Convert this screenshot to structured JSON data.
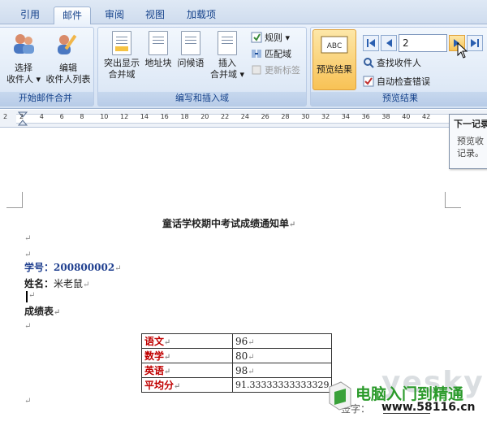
{
  "tabs": [
    {
      "label": "引用"
    },
    {
      "label": "邮件"
    },
    {
      "label": "审阅"
    },
    {
      "label": "视图"
    },
    {
      "label": "加载项"
    }
  ],
  "groups": {
    "start_merge": {
      "label": "开始邮件合并",
      "select_recipients_l1": "选择",
      "select_recipients_l2": "收件人",
      "edit_list_l1": "编辑",
      "edit_list_l2": "收件人列表"
    },
    "write_insert": {
      "label": "编写和插入域",
      "highlight_fields_l1": "突出显示",
      "highlight_fields_l2": "合并域",
      "address_block": "地址块",
      "greeting_line": "问候语",
      "insert_merge_field_l1": "插入",
      "insert_merge_field_l2": "合并域",
      "rules": "规则",
      "match_fields": "匹配域",
      "update_labels": "更新标签"
    },
    "preview": {
      "label": "预览结果",
      "preview_results": "预览结果",
      "record_number": "2",
      "find_recipient": "查找收件人",
      "auto_check_errors": "自动检查错误"
    }
  },
  "ruler": {
    "numbers": [
      "2",
      "2",
      "4",
      "6",
      "8",
      "10",
      "12",
      "14",
      "16",
      "18",
      "20",
      "22",
      "24",
      "26",
      "28",
      "30",
      "32",
      "34",
      "36",
      "38",
      "40",
      "42"
    ]
  },
  "tooltip": {
    "title": "下一记录",
    "line1": "预览收",
    "line2": "记录。"
  },
  "document": {
    "title": "童话学校期中考试成绩通知单",
    "student_id_label": "学号：",
    "student_id_value": "200800002",
    "name_label": "姓名：",
    "name_value": "米老鼠",
    "score_table_heading": "成绩表",
    "para_mark": "↵",
    "rows": [
      {
        "subject": "语文",
        "score": "96"
      },
      {
        "subject": "数学",
        "score": "80"
      },
      {
        "subject": "英语",
        "score": "98"
      },
      {
        "subject": "平均分",
        "score": "91.33333333333329"
      }
    ],
    "signature_fragment": "签字：",
    "watermark_brand": "yesky",
    "watermark_site_name": "电脑入门到精通",
    "watermark_url": "www.58116.cn"
  }
}
